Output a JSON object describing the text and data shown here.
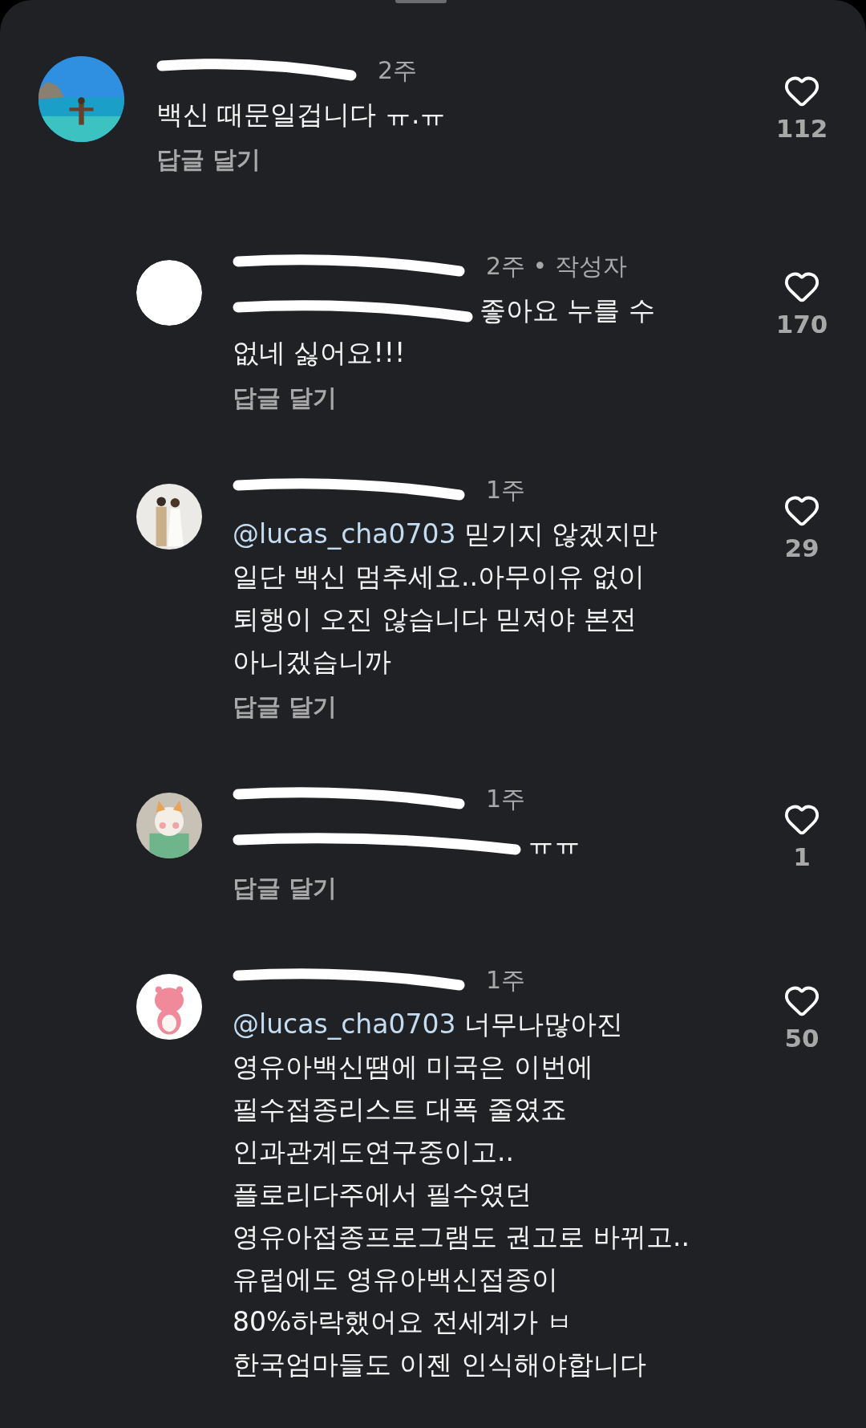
{
  "comments": [
    {
      "author_redacted": true,
      "time": "2주",
      "body": "백신 때문일겁니다 ㅠ.ㅠ",
      "reply_action": "답글 달기",
      "likes": "112",
      "replies": [
        {
          "avatar_redacted": true,
          "author_redacted": true,
          "time": "2주 • 작성자",
          "mention_redacted": true,
          "body": "좋아요 누를 수 없네 싫어요!!!",
          "reply_action": "답글 달기",
          "likes": "170"
        },
        {
          "author_redacted": true,
          "time": "1주",
          "mention": "@lucas_cha0703",
          "body": "믿기지 않겠지만 일단 백신 멈추세요..아무이유 없이 퇴행이 오진 않습니다 믿져야 본전 아니겠습니까",
          "reply_action": "답글 달기",
          "likes": "29"
        },
        {
          "author_redacted": true,
          "time": "1주",
          "body_redacted": true,
          "body": "ㅠㅠ",
          "reply_action": "답글 달기",
          "likes": "1"
        },
        {
          "author_redacted": true,
          "time": "1주",
          "mention": "@lucas_cha0703",
          "body": "너무나많아진\n영유아백신땜에 미국은 이번에\n필수접종리스트 대폭 줄였죠\n인과관계도연구중이고..\n플로리다주에서 필수였던\n영유아접종프로그램도 권고로 바뀌고..\n유럽에도 영유아백신접종이\n80%하락했어요 전세계가 ㅂ\n한국엄마들도 이젠  인식해야합니다",
          "likes": "50"
        }
      ]
    }
  ]
}
